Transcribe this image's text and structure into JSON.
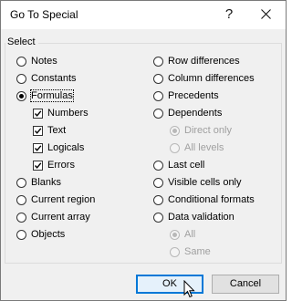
{
  "window": {
    "title": "Go To Special",
    "help_label": "?",
    "close_icon": "close-icon"
  },
  "group": {
    "label": "Select"
  },
  "left_options": [
    {
      "label": "Notes",
      "checked": false
    },
    {
      "label": "Constants",
      "checked": false
    },
    {
      "label": "Formulas",
      "checked": true
    },
    {
      "label": "Blanks",
      "checked": false
    },
    {
      "label": "Current region",
      "checked": false
    },
    {
      "label": "Current array",
      "checked": false
    },
    {
      "label": "Objects",
      "checked": false
    }
  ],
  "formula_types": [
    {
      "label": "Numbers",
      "checked": true
    },
    {
      "label": "Text",
      "checked": true
    },
    {
      "label": "Logicals",
      "checked": true
    },
    {
      "label": "Errors",
      "checked": true
    }
  ],
  "right_options": [
    {
      "label": "Row differences",
      "checked": false
    },
    {
      "label": "Column differences",
      "checked": false
    },
    {
      "label": "Precedents",
      "checked": false
    },
    {
      "label": "Dependents",
      "checked": false
    },
    {
      "label": "Last cell",
      "checked": false
    },
    {
      "label": "Visible cells only",
      "checked": false
    },
    {
      "label": "Conditional formats",
      "checked": false
    },
    {
      "label": "Data validation",
      "checked": false
    }
  ],
  "dependents_sub": [
    {
      "label": "Direct only",
      "checked": true,
      "enabled": false
    },
    {
      "label": "All levels",
      "checked": false,
      "enabled": false
    }
  ],
  "validation_sub": [
    {
      "label": "All",
      "checked": true,
      "enabled": false
    },
    {
      "label": "Same",
      "checked": false,
      "enabled": false
    }
  ],
  "buttons": {
    "ok": "OK",
    "cancel": "Cancel"
  },
  "colors": {
    "accent": "#0078d7",
    "disabled_text": "#a0a0a0"
  }
}
